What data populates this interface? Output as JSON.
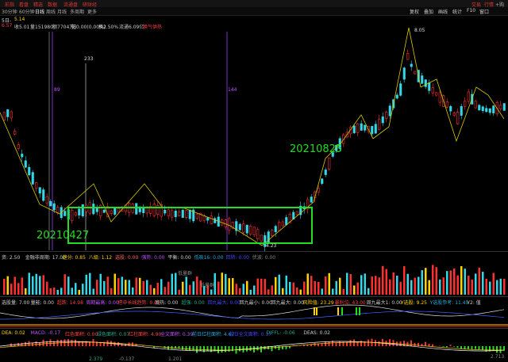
{
  "topbar": {
    "left_menu": [
      "前指",
      "看盘",
      "精选",
      "数据",
      "流通盘",
      "研财经"
    ],
    "right_menu": [
      "交易",
      "行情",
      "+购买"
    ]
  },
  "periodbar": {
    "periods": [
      "30分钟",
      "60分钟",
      "日线",
      "周线",
      "月线",
      "多周期",
      "更多"
    ],
    "tools": [
      "复权",
      "叠加",
      "画线",
      "统计",
      "F10",
      "窗口"
    ]
  },
  "quote": {
    "price_label": "5.14",
    "items": [
      "6.57",
      "收5.01",
      "量151980",
      "额7704万",
      "幅0.00(0.00%)",
      "换2.50%",
      "流通6.09亿",
      "换气供热"
    ]
  },
  "chart": {
    "high_label": "8.05",
    "marker_233": "233",
    "low_label": "4.23",
    "vline_labels": [
      "89",
      "144"
    ]
  },
  "annotations": {
    "date_start": "20210427",
    "date_end": "20210825"
  },
  "indicators": {
    "row1": [
      "资: 2.50",
      "金融非周期: 17.00",
      "趋分: 0.85",
      "八级: 1.12",
      "选股: 0.00",
      "强势: 0.00",
      "平衡: 0.00",
      "低吸16: 0.00",
      "回转: 0.00",
      "伏波: 0.00"
    ],
    "vol_labels": [
      "低量群",
      "低量群"
    ],
    "row2": [
      "选股量: 7.00",
      "量能: 0.00",
      "超跌: 14.98",
      "周期最高: 0.00",
      "把中长线趋势: 0.00",
      "底热: 0.00",
      "超强: 0.00",
      "回九最大: 0.00",
      "回九最小: 0.00",
      "回九最大: 0.00",
      "风险值: 23.29",
      "暴利位: 43.00",
      "周九最大1: 0.00",
      "Y选股: 9.25",
      "Y选股参考: 11.45",
      "Y2: 值"
    ],
    "row3": [
      "DEA: 0.02",
      "MACD: -0.17",
      "红色面积: 0.00",
      "绿色面积: 0.07",
      "红柱面积: 4.90",
      "全文面积: 0.39",
      "前日红柱面积: 4.67",
      "前日全文面积: 0.17",
      "DIFFL: -0.06",
      "DEAS: 0.02"
    ],
    "bottom_vals": [
      "2.379",
      "-0.137",
      "1.201",
      "2.713"
    ]
  }
}
